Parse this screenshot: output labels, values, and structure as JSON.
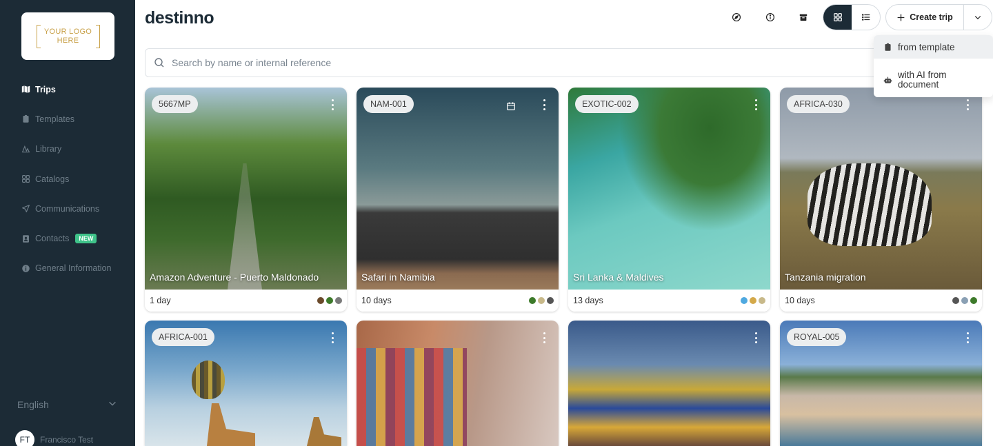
{
  "logo": {
    "text_line1": "YOUR LOGO",
    "text_line2": "HERE"
  },
  "brand": "destinno",
  "nav": [
    {
      "label": "Trips",
      "icon": "map-icon",
      "active": true
    },
    {
      "label": "Templates",
      "icon": "clipboard-icon"
    },
    {
      "label": "Library",
      "icon": "library-icon"
    },
    {
      "label": "Catalogs",
      "icon": "grid-icon"
    },
    {
      "label": "Communications",
      "icon": "send-icon"
    },
    {
      "label": "Contacts",
      "icon": "contact-icon",
      "badge": "NEW"
    },
    {
      "label": "General Information",
      "icon": "info-icon"
    }
  ],
  "language": "English",
  "user": {
    "initials": "FT",
    "name": "Francisco Test"
  },
  "header": {
    "create_label": "Create trip"
  },
  "dropdown": {
    "from_template": "from template",
    "with_ai_line1": "with AI from",
    "with_ai_line2": "document"
  },
  "search": {
    "placeholder": "Search by name or internal reference"
  },
  "colors": {
    "sidebar": "#1c2b36",
    "accent_new": "#3fc38a",
    "logo_gold": "#c9a24a"
  },
  "cards": [
    {
      "code": "5667MP",
      "title": "Amazon Adventure - Puerto Maldonado",
      "days": "1 day",
      "tags": [
        "#6b4a2b",
        "#3d7a2a",
        "#7a7a7a"
      ]
    },
    {
      "code": "NAM-001",
      "title": "Safari in Namibia",
      "days": "10 days",
      "tags": [
        "#3d7a2a",
        "#c8b98a",
        "#555555"
      ]
    },
    {
      "code": "EXOTIC-002",
      "title": "Sri Lanka & Maldives",
      "days": "13 days",
      "tags": [
        "#4fa9e0",
        "#d4a94a",
        "#c8b98a"
      ]
    },
    {
      "code": "AFRICA-030",
      "title": "Tanzania migration",
      "days": "10 days",
      "tags": [
        "#555555",
        "#8aa0b4",
        "#3d7a2a"
      ]
    },
    {
      "code": "AFRICA-001",
      "title": "",
      "days": "",
      "tags": []
    },
    {
      "code": "",
      "title": "",
      "days": "",
      "tags": []
    },
    {
      "code": "",
      "title": "",
      "days": "",
      "tags": []
    },
    {
      "code": "ROYAL-005",
      "title": "",
      "days": "",
      "tags": []
    }
  ]
}
